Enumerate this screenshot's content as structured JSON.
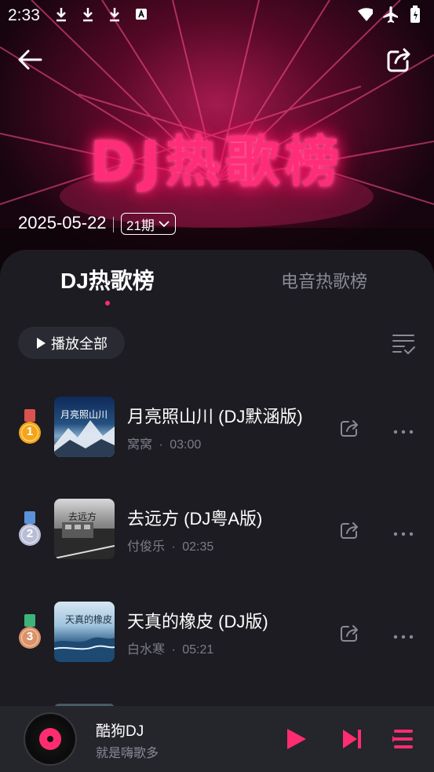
{
  "status_bar": {
    "time": "2:33",
    "left_icons": [
      "download-icon",
      "download-icon",
      "download-icon",
      "font-icon"
    ],
    "right_icons": [
      "wifi-icon",
      "airplane-icon",
      "battery-icon"
    ]
  },
  "header": {
    "title": "DJ热歌榜",
    "date": "2025-05-22",
    "period": "21期"
  },
  "tabs": [
    {
      "label": "DJ热歌榜",
      "active": true
    },
    {
      "label": "电音热歌榜",
      "active": false
    }
  ],
  "toolbar": {
    "play_all_label": "播放全部"
  },
  "songs": [
    {
      "rank": "1",
      "title": "月亮照山川 (DJ默涵版)",
      "artist": "窝窝",
      "duration": "03:00",
      "medal_color": "#f2a51c",
      "ribbon_color": "#d9534f",
      "cover_text": "月亮照山川"
    },
    {
      "rank": "2",
      "title": "去远方 (DJ粤A版)",
      "artist": "付俊乐",
      "duration": "02:35",
      "medal_color": "#b9bdd6",
      "ribbon_color": "#5a93d9",
      "cover_text": "去远方"
    },
    {
      "rank": "3",
      "title": "天真的橡皮 (DJ版)",
      "artist": "白水寒",
      "duration": "05:21",
      "medal_color": "#d9926a",
      "ribbon_color": "#3cb47a",
      "cover_text": "天真的橡皮"
    }
  ],
  "meta_separator": "·",
  "player": {
    "title": "酷狗DJ",
    "subtitle": "就是嗨歌多"
  },
  "colors": {
    "accent": "#ff2d6f",
    "background": "#17171c",
    "panel": "#1c1c22"
  }
}
